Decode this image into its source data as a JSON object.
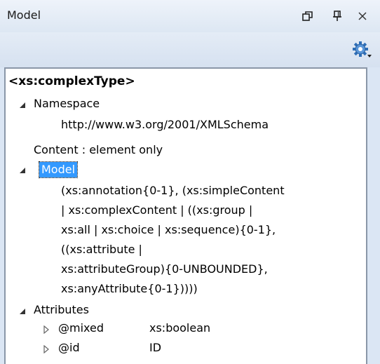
{
  "window": {
    "title": "Model"
  },
  "icons": {
    "restore": "restore-window-icon",
    "pin": "pin-icon",
    "close": "close-icon",
    "settings": "gear-settings-icon",
    "expanded": "expanded-triangle-icon",
    "collapsed": "collapsed-triangle-icon"
  },
  "tree": {
    "heading": "<xs:complexType>",
    "namespace": {
      "label": "Namespace",
      "value": "http://www.w3.org/2001/XMLSchema"
    },
    "content": "Content : element only",
    "model": {
      "label": "Model",
      "lines": [
        "(xs:annotation{0-1}, (xs:simpleContent",
        "| xs:complexContent | ((xs:group |",
        "xs:all | xs:choice | xs:sequence){0-1},",
        "((xs:attribute |",
        "xs:attributeGroup){0-UNBOUNDED},",
        "xs:anyAttribute{0-1}))))"
      ]
    },
    "attributes": {
      "label": "Attributes",
      "items": [
        {
          "name": "@mixed",
          "type": "xs:boolean"
        },
        {
          "name": "@id",
          "type": "ID"
        }
      ]
    }
  },
  "colors": {
    "selection": "#3399ff",
    "panel": "#dbe6f4"
  }
}
